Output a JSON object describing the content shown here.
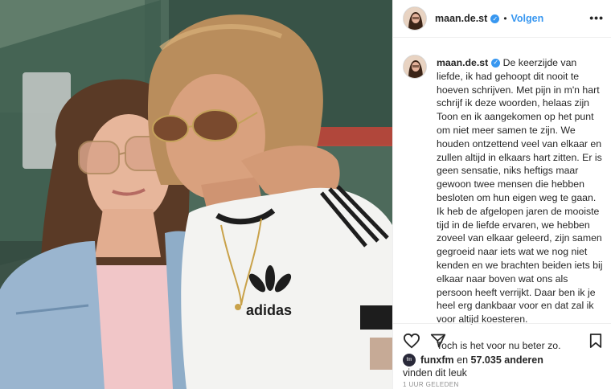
{
  "post": {
    "username": "maan.de.st",
    "follow_label": "Volgen",
    "separator": "•",
    "more_label": "•••",
    "caption_username": "maan.de.st",
    "caption_para1": "De keerzijde van liefde, ik had gehoopt dit nooit te hoeven schrijven. Met pijn in m'n hart schrijf ik deze woorden, helaas zijn Toon en ik aangekomen op het punt om niet meer samen te zijn. We houden ontzettend veel van elkaar en zullen altijd in elkaars hart zitten. Er is geen sensatie, niks heftigs maar gewoon twee mensen die hebben besloten om hun eigen weg te gaan.",
    "caption_para2": "Ik heb de afgelopen jaren de mooiste tijd in de liefde ervaren, we hebben zoveel van elkaar geleerd, zijn samen gegroeid naar iets wat we nog niet kenden en we brachten beiden iets bij elkaar naar boven wat ons als persoon heeft verrijkt. Daar ben ik je heel erg dankbaar voor en dat zal ik voor altijd koesteren.",
    "caption_para3": "Toch is het voor nu beter zo.",
    "likes_user": "funxfm",
    "likes_connector": "en",
    "likes_count": "57.035 anderen",
    "likes_suffix": "vinden dit leuk",
    "timestamp": "1 UUR GELEDEN",
    "shirt_brand": "adidas"
  },
  "icons": {
    "verified": "verified-badge-icon",
    "like": "heart-icon",
    "share": "paper-plane-icon",
    "save": "bookmark-icon",
    "more": "more-options-icon"
  },
  "colors": {
    "accent": "#3897f0",
    "text": "#262626",
    "muted": "#8e8e8e",
    "divider": "#efefef"
  }
}
